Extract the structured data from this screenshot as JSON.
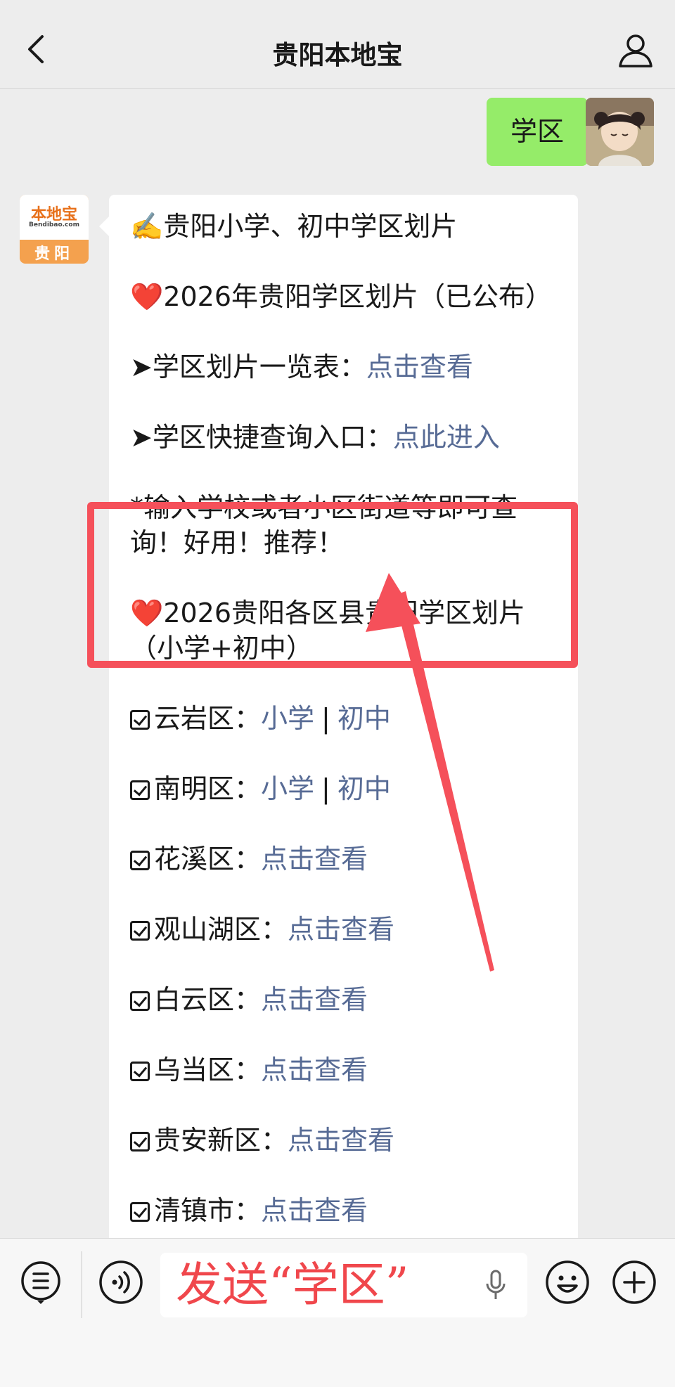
{
  "header": {
    "title": "贵阳本地宝"
  },
  "my_message": {
    "text": "学区"
  },
  "bot": {
    "avatar_logo": "本地宝",
    "avatar_site": "Bendibao.com",
    "avatar_city": "贵阳"
  },
  "message": {
    "line1": "✍️贵阳小学、初中学区划片",
    "line2": "❤️2026年贵阳学区划片（已公布）",
    "line3_label": "➤学区划片一览表：",
    "line3_link": "点击查看",
    "line4_label": "➤学区快捷查询入口：",
    "line4_link": "点此进入",
    "line5": "*输入学校或者小区街道等即可查询！好用！推荐！",
    "line6": "❤️2026贵阳各区县贵阳学区划片（小学+初中）",
    "districts": [
      {
        "name": "云岩区：",
        "link1": "小学",
        "sep": "|",
        "link2": "初中"
      },
      {
        "name": "南明区：",
        "link1": "小学",
        "sep": "|",
        "link2": "初中"
      },
      {
        "name": "花溪区：",
        "link1": "点击查看"
      },
      {
        "name": "观山湖区：",
        "link1": "点击查看"
      },
      {
        "name": "白云区：",
        "link1": "点击查看"
      },
      {
        "name": "乌当区：",
        "link1": "点击查看"
      },
      {
        "name": "贵安新区：",
        "link1": "点击查看"
      },
      {
        "name": "清镇市：",
        "link1": "点击查看"
      }
    ]
  },
  "input_bar": {
    "overlay_text": "发送“学区”"
  },
  "colors": {
    "link": "#576b95",
    "highlight": "#f5505a",
    "my_bubble": "#95ec69"
  }
}
